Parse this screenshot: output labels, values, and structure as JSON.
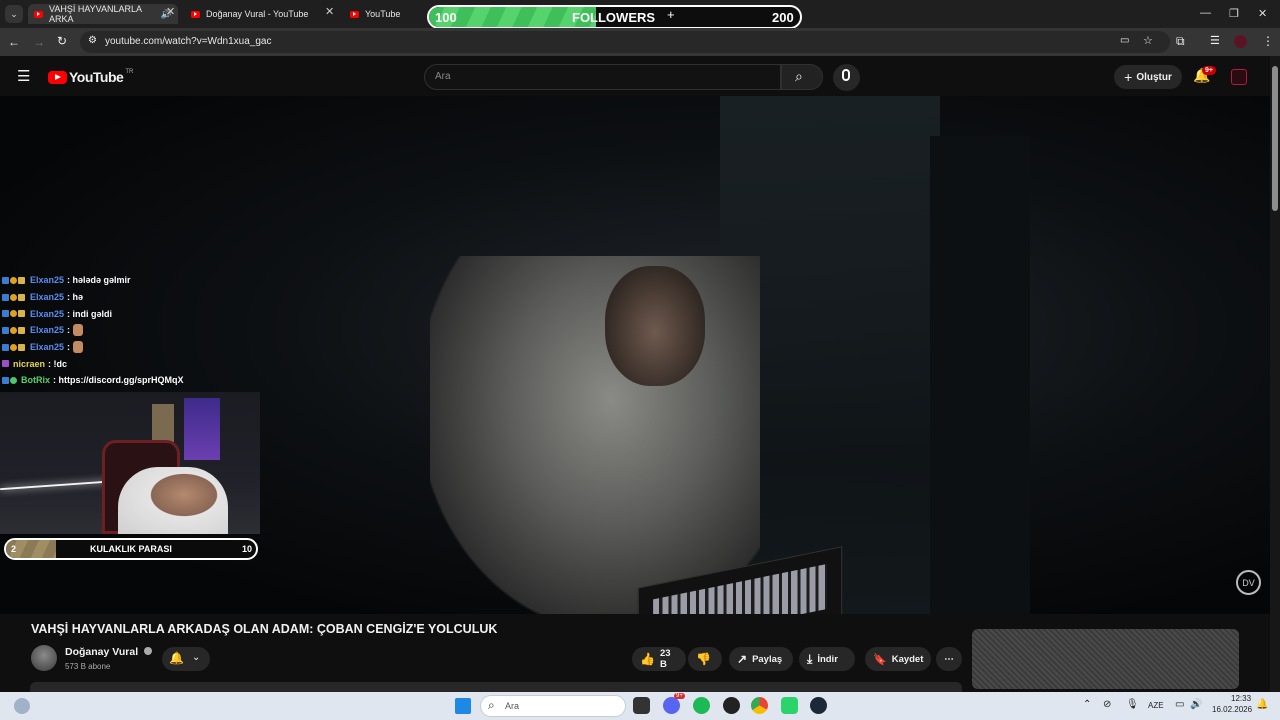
{
  "tabs": [
    {
      "label": "VAHŞİ HAYVANLARLA ARKA"
    },
    {
      "label": "Doğanay Vural - YouTube"
    },
    {
      "label": "YouTube"
    }
  ],
  "followers_goal": {
    "start": "100",
    "label": "FOLLOWERS",
    "end": "200",
    "progress": 0.45
  },
  "address": {
    "url": "youtube.com/watch?v=Wdn1xua_gac"
  },
  "yt_header": {
    "logo": "YouTube",
    "region": "TR",
    "search_placeholder": "Ara",
    "create_label": "Oluştur",
    "notif_count": "9+"
  },
  "chat": [
    {
      "user": "Elxan25",
      "message": ": hələdə gəlmir",
      "color": "blue"
    },
    {
      "user": "Elxan25",
      "message": ": hə",
      "color": "blue"
    },
    {
      "user": "Elxan25",
      "message": ": indi gəldi",
      "color": "blue"
    },
    {
      "user": "Elxan25",
      "message": ":",
      "color": "blue",
      "emote": true
    },
    {
      "user": "Elxan25",
      "message": ":",
      "color": "blue",
      "emote": true
    },
    {
      "user": "nicraen",
      "message": ": !dc",
      "color": "yellow"
    },
    {
      "user": "BotRix",
      "message": ": https://discord.gg/sprHQMqX",
      "color": "green"
    }
  ],
  "sub_goal": {
    "start": "2",
    "label": "KULAKLIK PARASI",
    "end": "10",
    "progress": 0.2
  },
  "video": {
    "title": "VAHŞİ HAYVANLARLA ARKADAŞ OLAN ADAM: ÇOBAN CENGİZ'E YOLCULUK",
    "channel": "Doğanay Vural",
    "subscribers": "573 B abone",
    "likes": "23 B",
    "share": "Paylaş",
    "download": "İndir",
    "save": "Kaydet",
    "watermark": "DV"
  },
  "taskbar": {
    "search_placeholder": "Ara",
    "language": "AZE",
    "time": "12:33",
    "date": "16.02.2026",
    "discord_badge": "9+"
  },
  "colors": {
    "accent_red": "#ff0000",
    "goal_green": "#4fcf64"
  }
}
